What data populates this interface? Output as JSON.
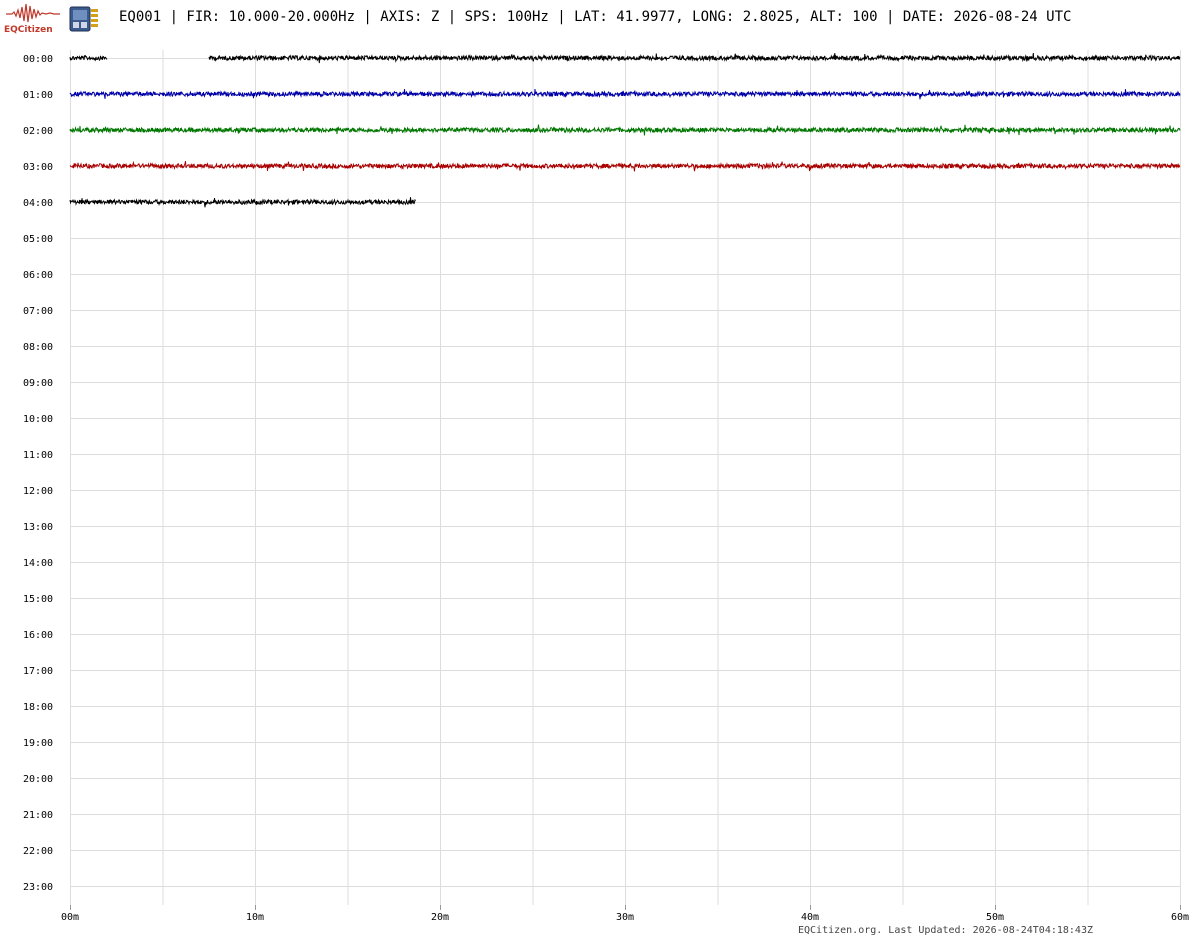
{
  "header": {
    "logo_text": "EQCitizen",
    "title": "EQ001 | FIR: 10.000-20.000Hz | AXIS: Z | SPS: 100Hz | LAT: 41.9977, LONG: 2.8025, ALT: 100 | DATE: 2026-08-24 UTC"
  },
  "footer": {
    "text": "EQCitizen.org. Last Updated: 2026-08-24T04:18:43Z"
  },
  "colors": {
    "grid": "#dddddd",
    "axis": "#cccccc",
    "text": "#000000",
    "trace_cycle": [
      "#000000",
      "#0000aa",
      "#007700",
      "#aa0000"
    ]
  },
  "icons": [
    "seismograph-logo-icon",
    "device-chip-icon"
  ],
  "chart_data": {
    "type": "line",
    "title": "",
    "xlabel": "",
    "ylabel": "",
    "x_tick_labels": [
      "00m",
      "10m",
      "20m",
      "30m",
      "40m",
      "50m",
      "60m"
    ],
    "x_ticks_minutes": [
      0,
      10,
      20,
      30,
      40,
      50,
      60
    ],
    "x_grid_minutes": [
      0,
      5,
      10,
      15,
      20,
      25,
      30,
      35,
      40,
      45,
      50,
      55,
      60
    ],
    "xlim": [
      0,
      60
    ],
    "grid": true,
    "row_labels": [
      "00:00",
      "01:00",
      "02:00",
      "03:00",
      "04:00",
      "05:00",
      "06:00",
      "07:00",
      "08:00",
      "09:00",
      "10:00",
      "11:00",
      "12:00",
      "13:00",
      "14:00",
      "15:00",
      "16:00",
      "17:00",
      "18:00",
      "19:00",
      "20:00",
      "21:00",
      "22:00",
      "23:00"
    ],
    "series": [
      {
        "row": "00:00",
        "color": "#000000",
        "segments_minutes": [
          [
            0,
            2.0
          ],
          [
            7.5,
            60
          ]
        ]
      },
      {
        "row": "01:00",
        "color": "#0000aa",
        "segments_minutes": [
          [
            0,
            60
          ]
        ]
      },
      {
        "row": "02:00",
        "color": "#007700",
        "segments_minutes": [
          [
            0,
            60
          ]
        ]
      },
      {
        "row": "03:00",
        "color": "#aa0000",
        "segments_minutes": [
          [
            0,
            60
          ]
        ]
      },
      {
        "row": "04:00",
        "color": "#000000",
        "segments_minutes": [
          [
            0,
            18.7
          ]
        ]
      }
    ]
  }
}
